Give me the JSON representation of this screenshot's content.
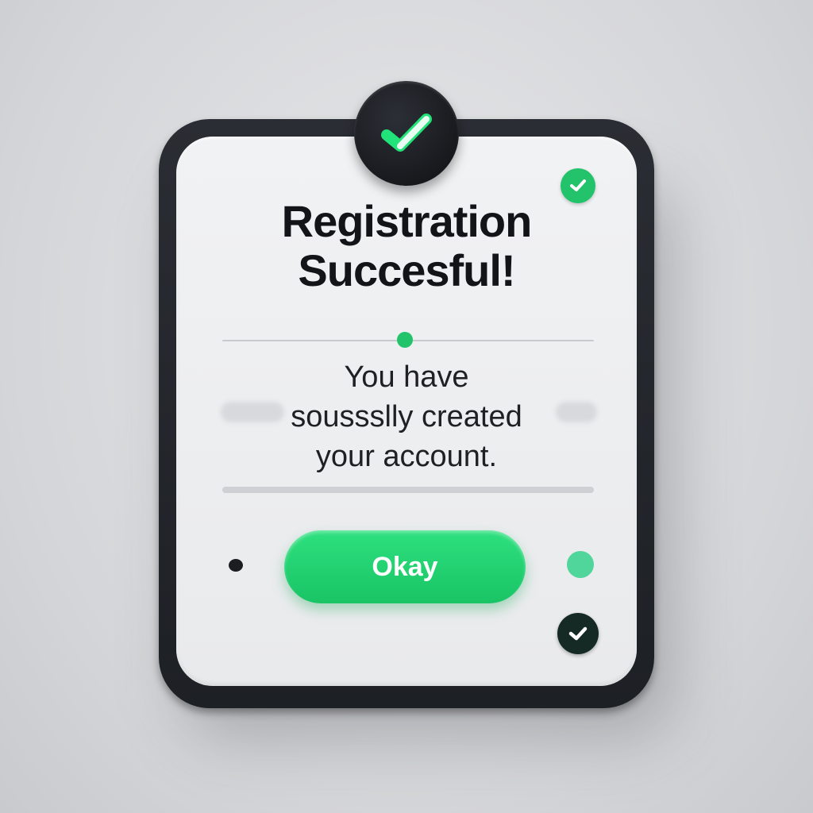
{
  "dialog": {
    "title_line1": "Registration",
    "title_line2": "Succesful!",
    "message_line1": "You have",
    "message_line2": "soussslly created",
    "message_line3": "your account.",
    "okay_label": "Okay"
  },
  "icons": {
    "top_badge": "checkmark-icon",
    "corner_badge": "checkmark-icon",
    "bottom_badge": "checkmark-icon"
  },
  "colors": {
    "accent": "#22c36b",
    "frame": "#1d2025",
    "panel": "#eeeff1",
    "text": "#121418"
  }
}
